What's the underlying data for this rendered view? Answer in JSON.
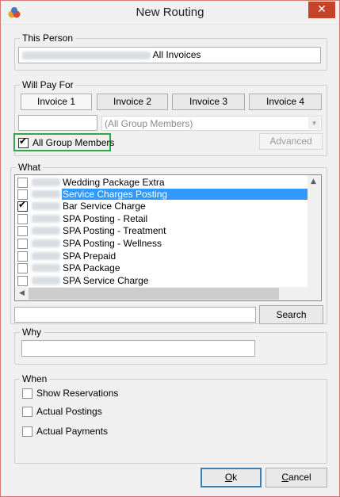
{
  "window": {
    "title": "New Routing",
    "close_glyph": "✕"
  },
  "this_person": {
    "legend": "This Person",
    "value_text": "All Invoices"
  },
  "will_pay_for": {
    "legend": "Will Pay For",
    "invoices": [
      "Invoice 1",
      "Invoice 2",
      "Invoice 3",
      "Invoice 4"
    ],
    "selected_invoice": "Invoice 1",
    "room_input_value": "",
    "member_combo_value": "(All Group Members)",
    "all_group_members_label": "All Group Members",
    "all_group_members_checked": true,
    "advanced_label": "Advanced"
  },
  "what": {
    "legend": "What",
    "items": [
      {
        "label": "Wedding Package Extra",
        "checked": false,
        "selected": false
      },
      {
        "label": "Service Charges Posting",
        "checked": false,
        "selected": true
      },
      {
        "label": "Bar Service Charge",
        "checked": true,
        "selected": false
      },
      {
        "label": "SPA Posting - Retail",
        "checked": false,
        "selected": false
      },
      {
        "label": "SPA Posting - Treatment",
        "checked": false,
        "selected": false
      },
      {
        "label": "SPA Posting - Wellness",
        "checked": false,
        "selected": false
      },
      {
        "label": "SPA Prepaid",
        "checked": false,
        "selected": false
      },
      {
        "label": "SPA Package",
        "checked": false,
        "selected": false
      },
      {
        "label": "SPA Service Charge",
        "checked": false,
        "selected": false
      }
    ],
    "search_input_value": "",
    "search_label": "Search"
  },
  "why": {
    "legend": "Why",
    "input_value": ""
  },
  "when": {
    "legend": "When",
    "options": [
      {
        "label": "Show Reservations",
        "checked": false
      },
      {
        "label": "Actual Postings",
        "checked": false
      },
      {
        "label": "Actual Payments",
        "checked": false
      }
    ]
  },
  "footer": {
    "ok_label": "Ok",
    "ok_mnemonic": "O",
    "ok_rest": "k",
    "cancel_label": "Cancel",
    "cancel_mnemonic": "C",
    "cancel_rest": "ancel"
  },
  "colors": {
    "selection": "#3399ff",
    "close_button": "#c7422b",
    "highlight_box": "#33a646",
    "default_button_border": "#3c7fb1"
  }
}
